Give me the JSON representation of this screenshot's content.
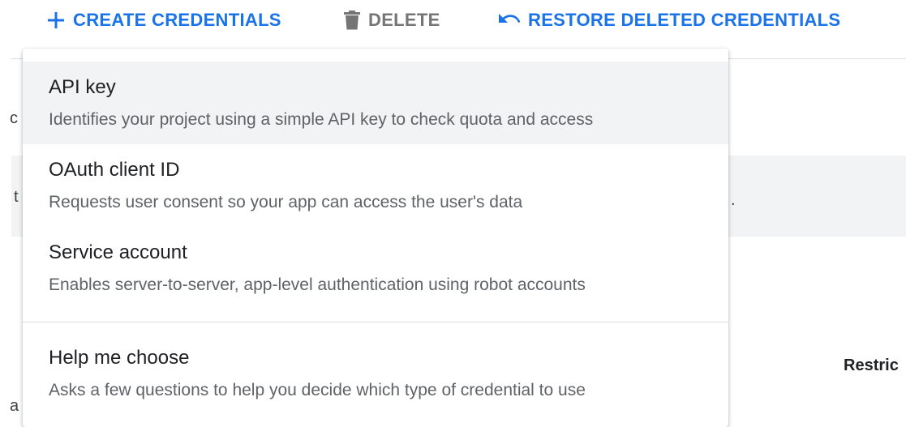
{
  "toolbar": {
    "create_label": "CREATE CREDENTIALS",
    "delete_label": "DELETE",
    "restore_label": "RESTORE DELETED CREDENTIALS"
  },
  "background": {
    "frag_1": "c",
    "frag_2": "t",
    "frag_3": "a",
    "frag_dot": ".",
    "column_header": "Restric"
  },
  "menu": {
    "items": [
      {
        "title": "API key",
        "description": "Identifies your project using a simple API key to check quota and access"
      },
      {
        "title": "OAuth client ID",
        "description": "Requests user consent so your app can access the user's data"
      },
      {
        "title": "Service account",
        "description": "Enables server-to-server, app-level authentication using robot accounts"
      },
      {
        "title": "Help me choose",
        "description": "Asks a few questions to help you decide which type of credential to use"
      }
    ]
  },
  "colors": {
    "accent": "#1a73e8",
    "disabled": "#757575",
    "hover_bg": "#f1f3f4"
  },
  "icons": {
    "create": "plus-icon",
    "delete": "trash-icon",
    "restore": "undo-icon"
  }
}
